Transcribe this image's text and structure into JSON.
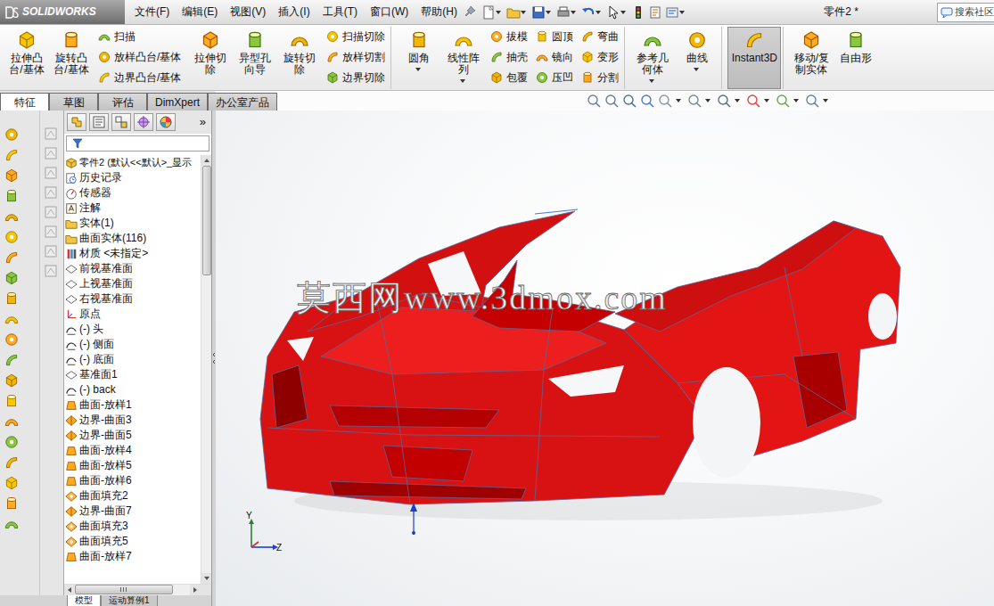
{
  "app": {
    "logo": "SOLIDWORKS"
  },
  "menu": [
    "文件(F)",
    "编辑(E)",
    "视图(V)",
    "插入(I)",
    "工具(T)",
    "窗口(W)",
    "帮助(H)"
  ],
  "window": {
    "title": "零件2 *"
  },
  "search": {
    "placeholder": "搜索社区"
  },
  "ribbon": [
    {
      "kind": "large",
      "items": [
        {
          "label": "拉伸凸台/基体",
          "selected": false,
          "dropdown": false
        },
        {
          "label": "旋转凸台/基体",
          "selected": false,
          "dropdown": false
        }
      ]
    },
    {
      "kind": "stack",
      "items": [
        {
          "label": "扫描",
          "selected": false,
          "dropdown": false
        },
        {
          "label": "放样凸台/基体",
          "selected": false,
          "dropdown": false
        },
        {
          "label": "边界凸台/基体",
          "selected": false,
          "dropdown": false
        }
      ]
    },
    {
      "kind": "large",
      "items": [
        {
          "label": "拉伸切除",
          "selected": false,
          "dropdown": false
        },
        {
          "label": "异型孔向导",
          "selected": false,
          "dropdown": false
        },
        {
          "label": "旋转切除",
          "selected": false,
          "dropdown": false
        }
      ]
    },
    {
      "kind": "stack",
      "items": [
        {
          "label": "扫描切除",
          "selected": false,
          "dropdown": false
        },
        {
          "label": "放样切割",
          "selected": false,
          "dropdown": false
        },
        {
          "label": "边界切除",
          "selected": false,
          "dropdown": false
        }
      ]
    },
    {
      "kind": "large",
      "items": [
        {
          "label": "圆角",
          "selected": false,
          "dropdown": true
        },
        {
          "label": "线性阵列",
          "selected": false,
          "dropdown": true
        }
      ]
    },
    {
      "kind": "stack",
      "items": [
        {
          "label": "拔模",
          "selected": false,
          "dropdown": false
        },
        {
          "label": "抽壳",
          "selected": false,
          "dropdown": false
        },
        {
          "label": "包覆",
          "selected": false,
          "dropdown": false
        }
      ]
    },
    {
      "kind": "stack",
      "items": [
        {
          "label": "圆顶",
          "selected": false,
          "dropdown": false
        },
        {
          "label": "镜向",
          "selected": false,
          "dropdown": false
        },
        {
          "label": "压凹",
          "selected": false,
          "dropdown": false
        }
      ]
    },
    {
      "kind": "stack",
      "items": [
        {
          "label": "弯曲",
          "selected": false,
          "dropdown": false
        },
        {
          "label": "变形",
          "selected": false,
          "dropdown": false
        },
        {
          "label": "分割",
          "selected": false,
          "dropdown": false
        }
      ]
    },
    {
      "kind": "large",
      "items": [
        {
          "label": "参考几何体",
          "selected": false,
          "dropdown": true
        },
        {
          "label": "曲线",
          "selected": false,
          "dropdown": true
        }
      ]
    },
    {
      "kind": "large",
      "items": [
        {
          "label": "Instant3D",
          "selected": true,
          "dropdown": false
        }
      ]
    },
    {
      "kind": "large",
      "items": [
        {
          "label": "移动/复制实体",
          "selected": false,
          "dropdown": false
        },
        {
          "label": "自由形",
          "selected": false,
          "dropdown": false
        }
      ]
    }
  ],
  "tabs": [
    {
      "label": "特征",
      "selected": true
    },
    {
      "label": "草图",
      "selected": false
    },
    {
      "label": "评估",
      "selected": false
    },
    {
      "label": "DimXpert",
      "selected": false
    },
    {
      "label": "办公室产品",
      "selected": false
    }
  ],
  "tree": {
    "more": "»",
    "items": [
      {
        "label": "零件2 (默认<<默认>_显示",
        "kind": "part"
      },
      {
        "label": "历史记录",
        "kind": "history"
      },
      {
        "label": "传感器",
        "kind": "sensor"
      },
      {
        "label": "注解",
        "kind": "annotation"
      },
      {
        "label": "实体(1)",
        "kind": "folder"
      },
      {
        "label": "曲面实体(116)",
        "kind": "folder"
      },
      {
        "label": "材质 <未指定>",
        "kind": "material"
      },
      {
        "label": "前视基准面",
        "kind": "plane"
      },
      {
        "label": "上视基准面",
        "kind": "plane"
      },
      {
        "label": "右视基准面",
        "kind": "plane"
      },
      {
        "label": "原点",
        "kind": "origin"
      },
      {
        "label": "(-) 头",
        "kind": "sketch"
      },
      {
        "label": "(-) 侧面",
        "kind": "sketch"
      },
      {
        "label": "(-) 底面",
        "kind": "sketch"
      },
      {
        "label": "基准面1",
        "kind": "plane"
      },
      {
        "label": "(-) back",
        "kind": "sketch"
      },
      {
        "label": "曲面-放样1",
        "kind": "loft"
      },
      {
        "label": "边界-曲面3",
        "kind": "boundary"
      },
      {
        "label": "边界-曲面5",
        "kind": "boundary"
      },
      {
        "label": "曲面-放样4",
        "kind": "loft"
      },
      {
        "label": "曲面-放样5",
        "kind": "loft"
      },
      {
        "label": "曲面-放样6",
        "kind": "loft"
      },
      {
        "label": "曲面填充2",
        "kind": "fill"
      },
      {
        "label": "边界-曲面7",
        "kind": "boundary"
      },
      {
        "label": "曲面填充3",
        "kind": "fill"
      },
      {
        "label": "曲面填充5",
        "kind": "fill"
      },
      {
        "label": "曲面-放样7",
        "kind": "loft"
      }
    ],
    "vscroll": {
      "level": 0.27
    },
    "hscroll": {
      "level": 0.85
    }
  },
  "viewport": {
    "watermark": "莫西网www.3dmox.com",
    "axes": [
      "Y",
      "Z"
    ]
  },
  "bottom_tabs": [
    {
      "label": "模型",
      "selected": true
    },
    {
      "label": "运动算例1",
      "selected": false
    }
  ]
}
